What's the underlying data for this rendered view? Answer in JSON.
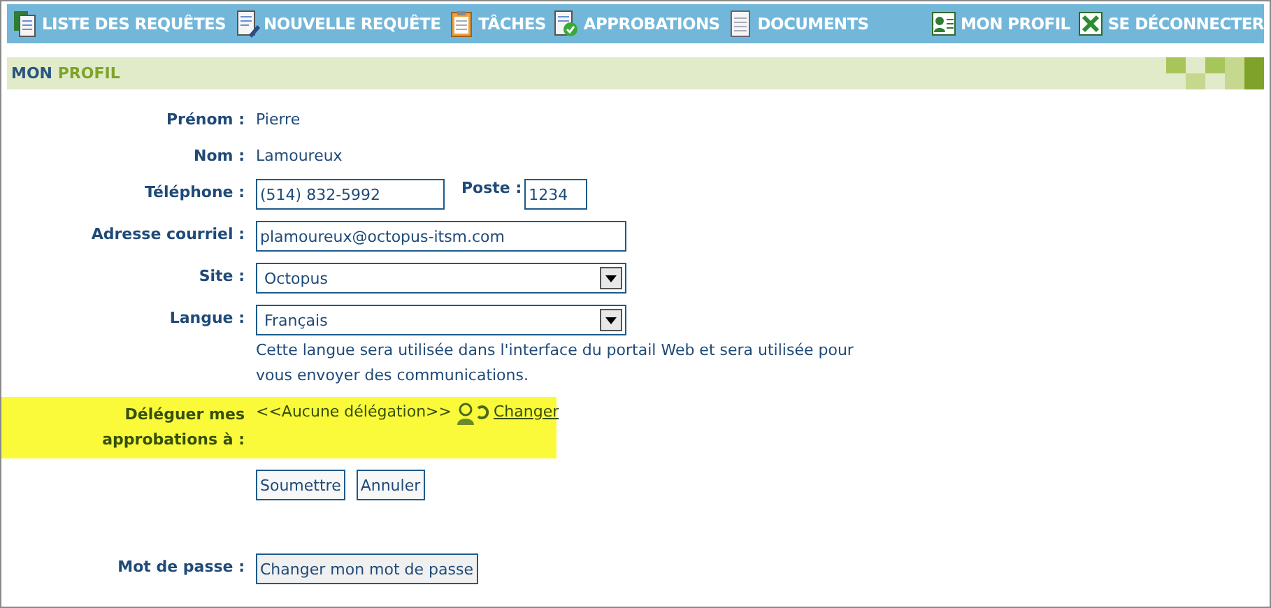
{
  "nav": {
    "left": [
      {
        "label": "LISTE DES REQUÊTES"
      },
      {
        "label": "NOUVELLE REQUÊTE"
      },
      {
        "label": "TÂCHES"
      },
      {
        "label": "APPROBATIONS"
      },
      {
        "label": "DOCUMENTS"
      }
    ],
    "right": [
      {
        "label": "MON PROFIL"
      },
      {
        "label": "SE DÉCONNECTER"
      }
    ]
  },
  "title": {
    "first": "MON",
    "second": "PROFIL"
  },
  "rows": [
    {
      "kind": "text",
      "label": "Prénom :",
      "value": "Pierre"
    },
    {
      "kind": "text",
      "label": "Nom :",
      "value": "Lamoureux"
    },
    {
      "kind": "phone",
      "label": "Téléphone :",
      "value": "(514) 832-5992",
      "extra_label": "Poste :",
      "extra_value": "1234"
    },
    {
      "kind": "input",
      "label": "Adresse courriel :",
      "value": "plamoureux@octopus-itsm.com"
    },
    {
      "kind": "select",
      "label": "Site :",
      "value": "Octopus"
    },
    {
      "kind": "select",
      "label": "Langue :",
      "value": "Français",
      "note": "Cette langue sera utilisée dans l'interface du portail Web et sera utilisée pour vous envoyer des communications."
    },
    {
      "kind": "delegation",
      "label": "Déléguer mes approbations à :",
      "value": "<<Aucune délégation>>",
      "link": "Changer",
      "highlighted": true
    },
    {
      "kind": "buttons",
      "buttons": [
        "Soumettre",
        "Annuler"
      ]
    },
    {
      "kind": "spacer"
    },
    {
      "kind": "button",
      "label": "Mot de passe :",
      "button": "Changer mon mot de passe"
    }
  ]
}
